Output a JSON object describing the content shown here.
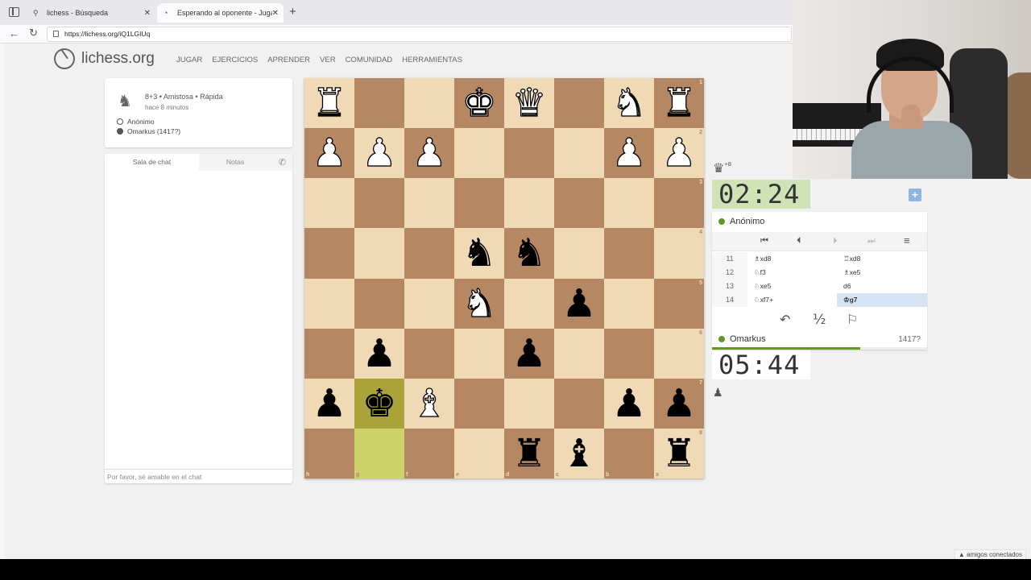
{
  "browser": {
    "tabs": [
      {
        "label": "lichess - Búsqueda",
        "close": "✕"
      },
      {
        "label": "Esperando al oponente - Jugar Aj",
        "close": "✕"
      }
    ],
    "new_tab": "+",
    "url": "https://lichess.org/iQ1LGIUq"
  },
  "header": {
    "logo": "lichess.org",
    "nav": [
      "JUGAR",
      "EJERCICIOS",
      "APRENDER",
      "VER",
      "COMUNIDAD",
      "HERRAMIENTAS"
    ]
  },
  "game_info": {
    "setup": "8+3 • Amistosa • Rápida",
    "ago": "hace 8 minutos",
    "players": [
      "Anónimo",
      "Omarkus (1417?)"
    ]
  },
  "chat": {
    "tabs": [
      "Sala de chat",
      "Notas"
    ],
    "placeholder": "Por favor, sé amable en el chat"
  },
  "board": {
    "files": [
      "h",
      "g",
      "f",
      "e",
      "d",
      "c",
      "b",
      "a"
    ],
    "ranks": [
      "1",
      "2",
      "3",
      "4",
      "5",
      "6",
      "7",
      "8"
    ],
    "rows": [
      [
        "wR",
        "",
        "",
        "wK",
        "wQ",
        "",
        "wN",
        "wR"
      ],
      [
        "wP",
        "wP",
        "wP",
        "",
        "",
        "",
        "wP",
        "wP"
      ],
      [
        "",
        "",
        "",
        "",
        "",
        "",
        "",
        ""
      ],
      [
        "",
        "",
        "",
        "bN",
        "bN",
        "",
        "",
        ""
      ],
      [
        "",
        "",
        "",
        "wN",
        "",
        "bP",
        "",
        ""
      ],
      [
        "",
        "bP",
        "",
        "",
        "bP",
        "",
        "",
        ""
      ],
      [
        "bP",
        "bK",
        "wB",
        "",
        "",
        "",
        "bP",
        "bP"
      ],
      [
        "",
        "",
        "",
        "",
        "bR",
        "bB",
        "",
        "bR"
      ]
    ],
    "last_move": [
      [
        6,
        1
      ],
      [
        7,
        1
      ]
    ],
    "colors": {
      "light": "#f0d9b5",
      "dark": "#b58863",
      "highlight": "#cdd26a"
    }
  },
  "right_panel": {
    "captured": {
      "piece": "♛",
      "diff": "+8"
    },
    "clock_top": "02:24",
    "clock_bottom": "05:44",
    "top_player": "Anónimo",
    "bottom_player": "Omarkus",
    "bottom_rating": "1417?",
    "nav_buttons": {
      "first": "⏮",
      "prev": "⏴",
      "next": "⏵",
      "last": "⏭",
      "menu": "≡"
    },
    "moves": [
      {
        "n": "11",
        "white": "♗xd8",
        "black": "♖xd8"
      },
      {
        "n": "12",
        "white": "♘f3",
        "black": "♗xe5"
      },
      {
        "n": "13",
        "white": "♘xe5",
        "black": "d6"
      },
      {
        "n": "14",
        "white": "♘xf7+",
        "black": "♔g7"
      }
    ],
    "actions": {
      "takeback": "↶",
      "draw": "½",
      "resign": "⚐"
    },
    "clock_progress": 0.69
  },
  "footer": {
    "friends": "▲ amigos conectados"
  }
}
